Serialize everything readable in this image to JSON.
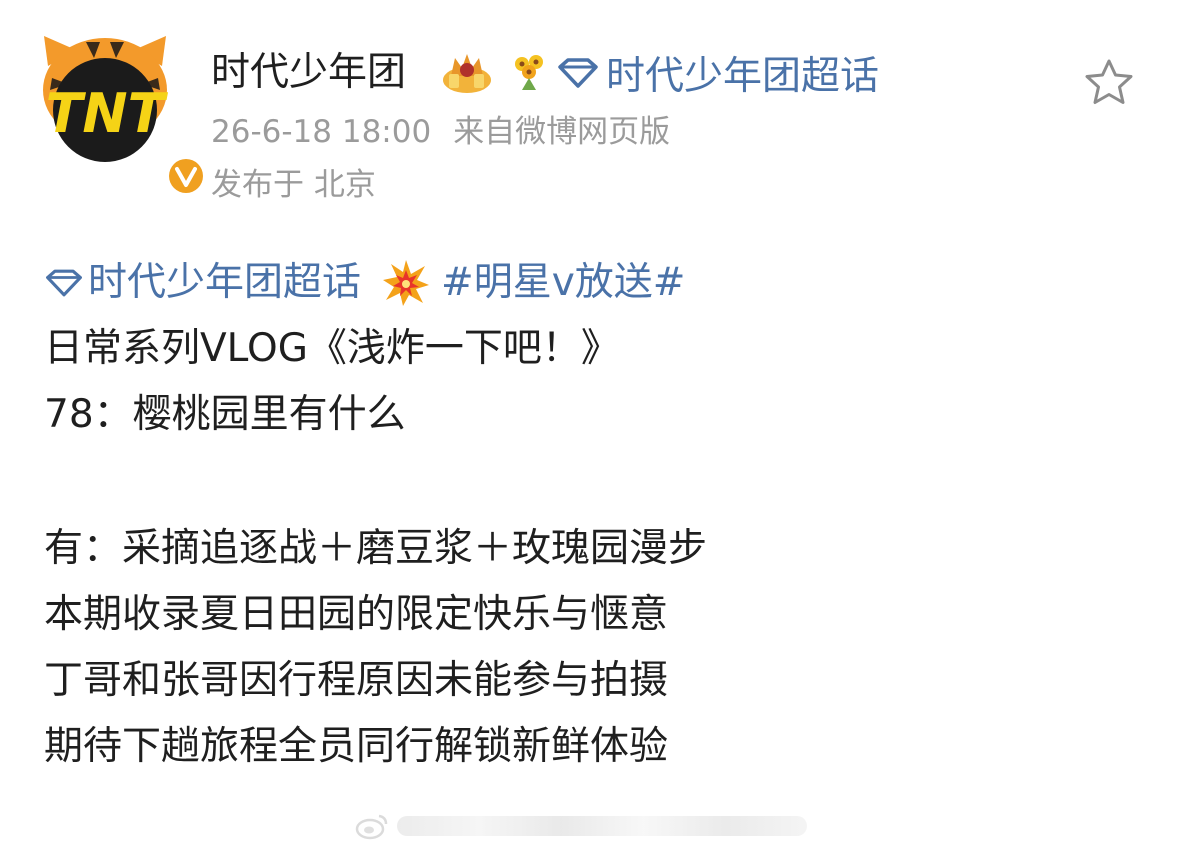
{
  "post": {
    "author": {
      "name": "时代少年团",
      "avatar_text": "TNT",
      "verified": true
    },
    "supertopic_label": "时代少年团超话",
    "timestamp": "26-6-18 18:00",
    "source": "来自微博网页版",
    "location": "发布于 北京",
    "favorite_icon": "star-outline-icon"
  },
  "content": {
    "topic_tag": "时代少年团超话",
    "hashtag": "#明星v放送#",
    "lines": [
      "日常系列VLOG《浅炸一下吧！》",
      "78：樱桃园里有什么",
      "有：采摘追逐战＋磨豆浆＋玫瑰园漫步",
      "本期收录夏日田园的限定快乐与惬意",
      "丁哥和张哥因行程原因未能参与拍摄",
      "期待下趟旅程全员同行解锁新鲜体验"
    ]
  },
  "colors": {
    "link": "#4a72a8",
    "meta": "#9b9b9b",
    "text": "#1f1f1f",
    "avatar_yellow": "#f5d316",
    "avatar_orange": "#f39a2b",
    "verified": "#f0a020"
  }
}
